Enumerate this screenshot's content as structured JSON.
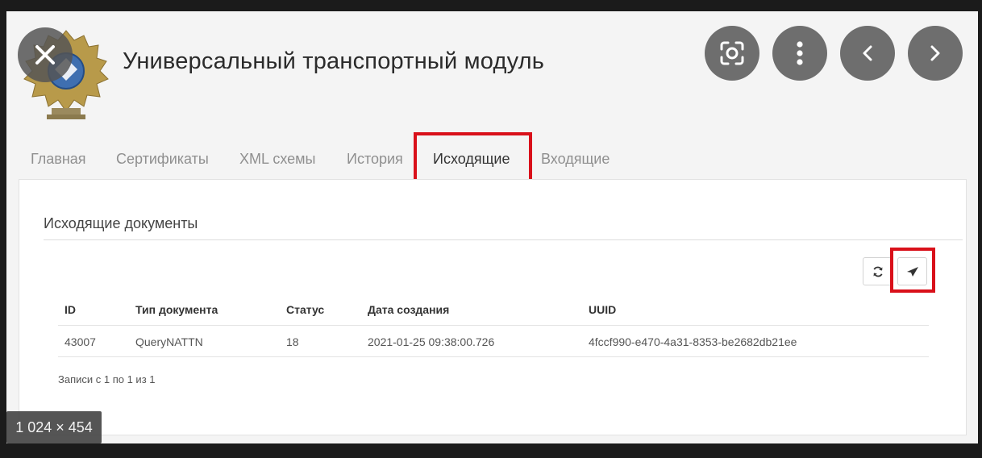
{
  "header": {
    "title": "Универсальный транспортный модуль",
    "emblem_icon": "coat-of-arms-icon"
  },
  "overlay_buttons": {
    "close_icon": "close-icon",
    "lens_icon": "lens-search-icon",
    "more_icon": "more-vertical-icon",
    "prev_icon": "chevron-left-icon",
    "next_icon": "chevron-right-icon"
  },
  "tabs": [
    {
      "label": "Главная"
    },
    {
      "label": "Сертификаты"
    },
    {
      "label": "XML схемы"
    },
    {
      "label": "История"
    },
    {
      "label": "Исходящие",
      "active": true
    },
    {
      "label": "Входящие"
    }
  ],
  "panel": {
    "title": "Исходящие документы",
    "refresh_icon": "refresh-icon",
    "send_icon": "send-icon"
  },
  "table": {
    "columns": [
      "ID",
      "Тип документа",
      "Статус",
      "Дата создания",
      "UUID"
    ],
    "rows": [
      [
        "43007",
        "QueryNATTN",
        "18",
        "2021-01-25 09:38:00.726",
        "4fccf990-e470-4a31-8353-be2682db21ee"
      ]
    ]
  },
  "records_info": "Записи с 1 по 1 из 1",
  "image_size_badge": "1 024 × 454",
  "colors": {
    "highlight": "#d9101a",
    "overlay_button": "#6e6e6e",
    "background": "#1b1b1b"
  }
}
